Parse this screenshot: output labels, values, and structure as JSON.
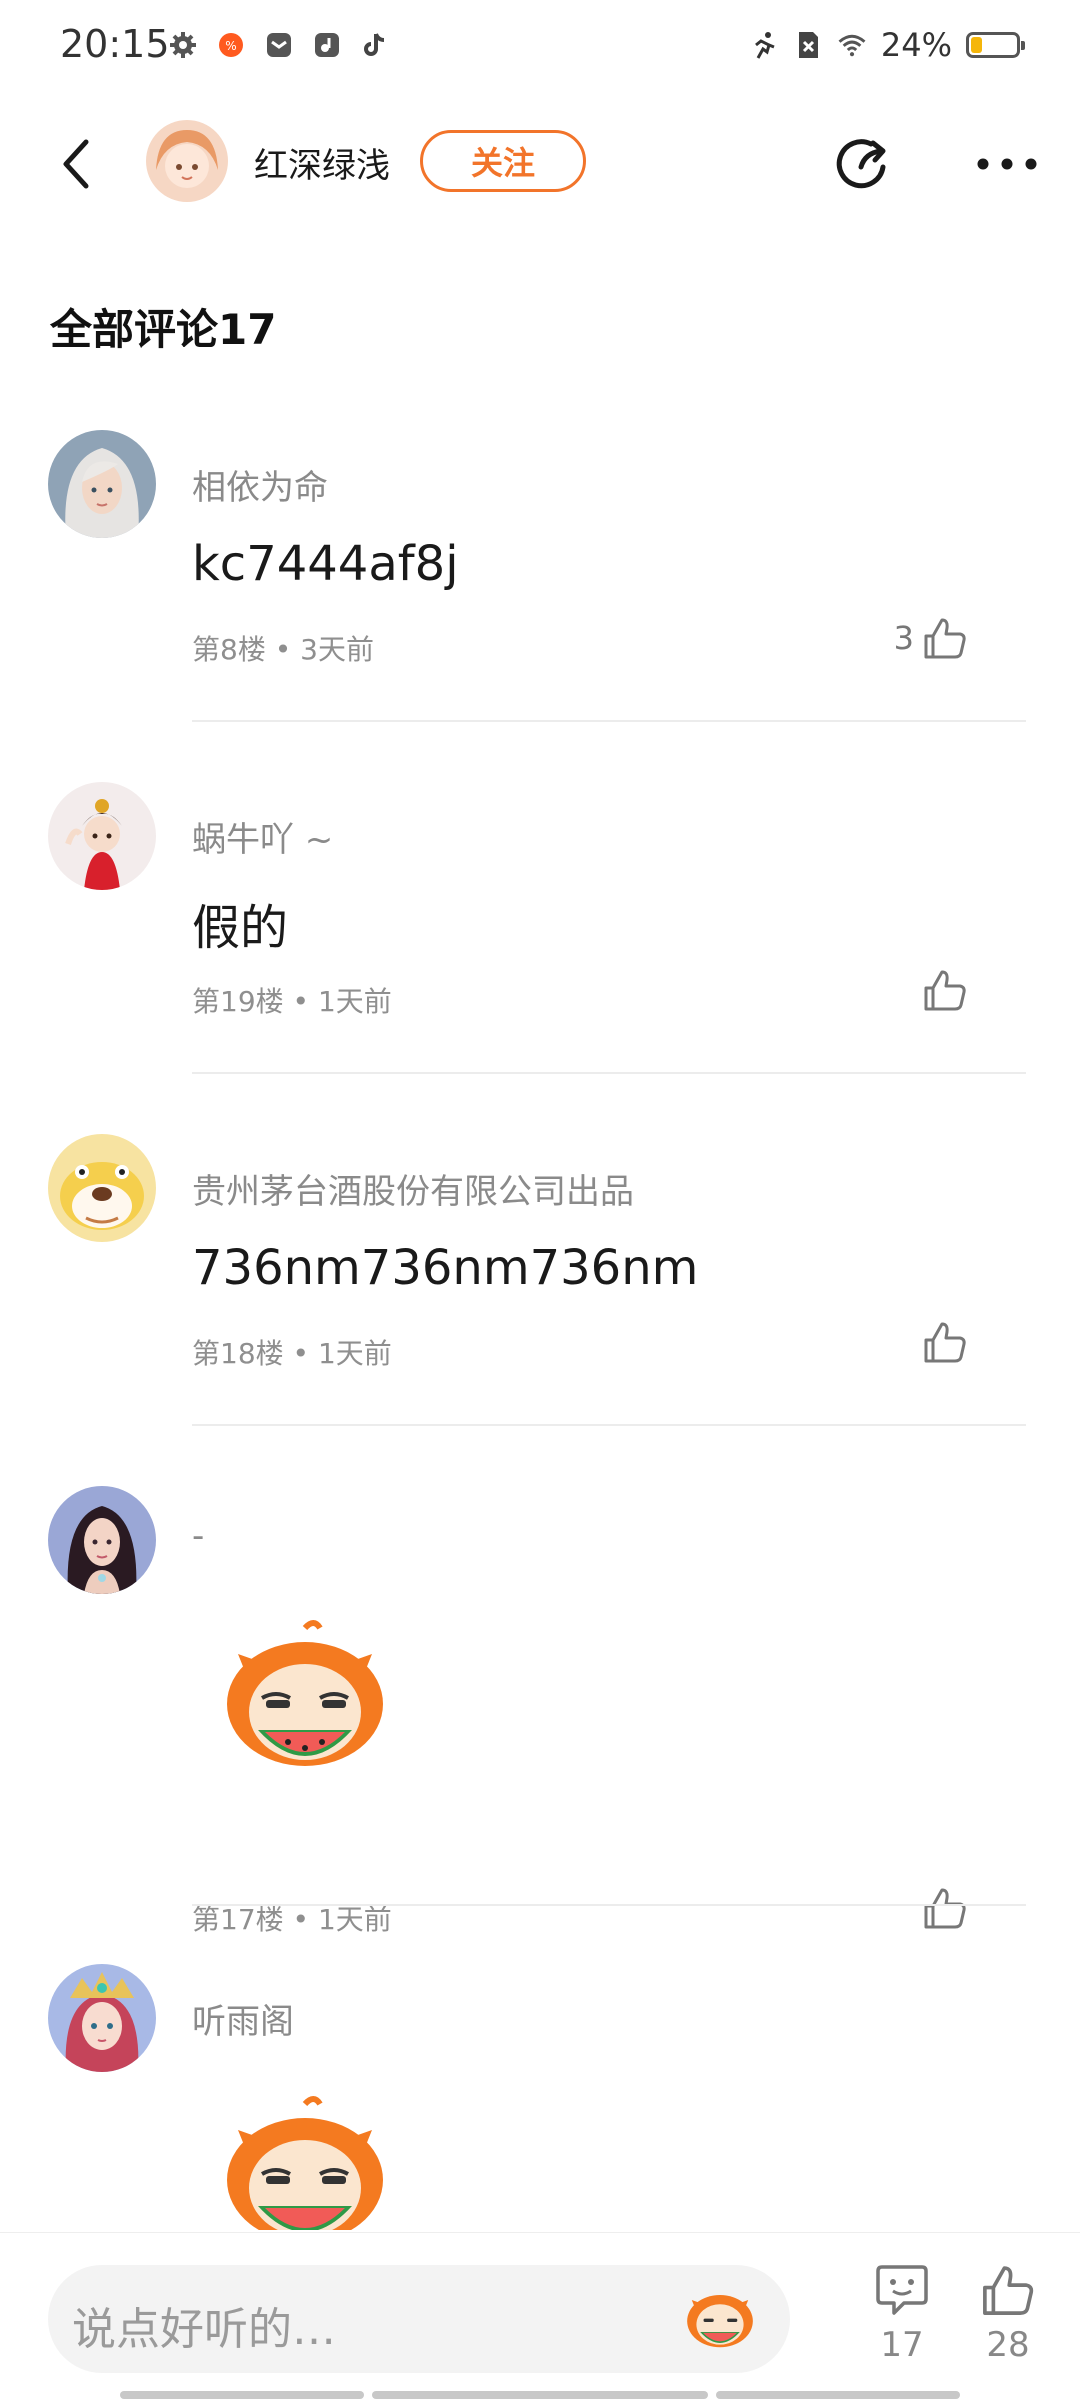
{
  "status_bar": {
    "time": "20:15",
    "battery_percent": "24%",
    "battery_level": 0.24,
    "left_icons": [
      "settings-icon",
      "taobao-icon",
      "mail-icon",
      "music-app-icon",
      "tiktok-icon"
    ],
    "right_icons": [
      "running-icon",
      "no-sim-icon",
      "wifi-icon",
      "battery-icon"
    ]
  },
  "header": {
    "author_name": "红深绿浅",
    "follow_label": "关注",
    "accent_color": "#f2742a"
  },
  "comments_header": {
    "title": "全部评论17"
  },
  "comments": [
    {
      "user": "相依为命",
      "text": "kc7444af8j",
      "meta": "第8楼 • 3天前",
      "likes": "3"
    },
    {
      "user": "蜗牛吖 ~",
      "text": "假的",
      "meta": "第19楼 • 1天前",
      "likes": ""
    },
    {
      "user": "贵州茅台酒股份有限公司出品",
      "text": "736nm736nm736nm",
      "meta": "第18楼 • 1天前",
      "likes": ""
    },
    {
      "user": "-",
      "text": "",
      "meta": "第17楼 • 1天前",
      "likes": ""
    },
    {
      "user": "听雨阁",
      "text": "",
      "meta": "",
      "likes": ""
    }
  ],
  "bottom_bar": {
    "input_placeholder": "说点好听的…",
    "comment_count": "17",
    "like_count": "28"
  }
}
